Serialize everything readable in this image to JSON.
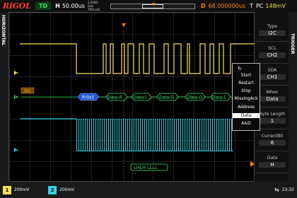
{
  "header": {
    "brand": "RIGOL",
    "run_state": "TD",
    "mode": "H",
    "timebase": "50.00us",
    "sample_rate": "1.000G Sa/s",
    "memory_depth": "700k pts",
    "delay_label": "D",
    "delay_value": "68.000000us",
    "trigger_type": "T",
    "trigger_source": "PC",
    "trigger_level": "148mV"
  },
  "left_label": "HORIZONTAL",
  "trigger_tab": "TRIGGER",
  "menu": {
    "items": [
      {
        "label": "Type",
        "value": "I2C"
      },
      {
        "label": "SCL",
        "value": "CH2"
      },
      {
        "label": "SDA",
        "value": "CH1"
      },
      {
        "label": "When",
        "value": "Data"
      },
      {
        "label": "Byte Length",
        "value": "1"
      },
      {
        "label": "CurrentBit",
        "value": "6"
      },
      {
        "label": "Data",
        "value": "H"
      }
    ]
  },
  "when_popup": {
    "items": [
      "Start",
      "Restart",
      "Stop",
      "MissingAck",
      "Address",
      "Data",
      "A&D"
    ],
    "selected": "Data"
  },
  "decode": {
    "bus_label": "I2C",
    "address_packet": "R:0x1",
    "data_packets": [
      "Data:R",
      "Data:I",
      "Data:G",
      "Data:O",
      "Data:L"
    ]
  },
  "trigger_pattern": "LHLH LLLL",
  "channel_markers": {
    "ch1": "1",
    "ch2": "2",
    "bus": "B"
  },
  "bottom": {
    "ch1_scale": "200mV",
    "ch2_scale": "200mV",
    "time": "23:32"
  },
  "colors": {
    "ch1": "#f5e05a",
    "ch2": "#2fd1e6",
    "decode_addr": "#1e5bd8",
    "decode_data": "#1f9a33",
    "trigger": "#f58220"
  }
}
